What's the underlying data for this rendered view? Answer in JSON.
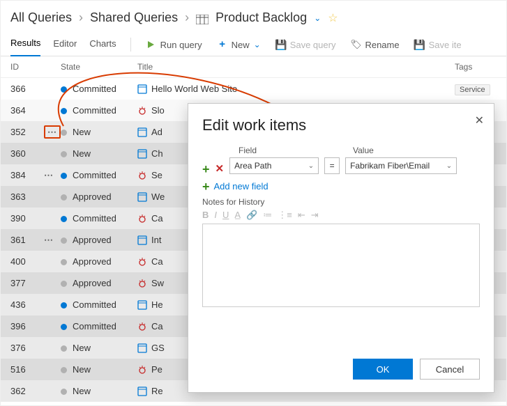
{
  "breadcrumb": {
    "root": "All Queries",
    "mid": "Shared Queries",
    "leaf": "Product Backlog"
  },
  "tabs": {
    "results": "Results",
    "editor": "Editor",
    "charts": "Charts"
  },
  "toolbar": {
    "run": "Run query",
    "new": "New",
    "save": "Save query",
    "rename": "Rename",
    "save_items": "Save ite"
  },
  "columns": {
    "id": "ID",
    "state": "State",
    "title": "Title",
    "tags": "Tags"
  },
  "rows": [
    {
      "id": "366",
      "state": "Committed",
      "dot": "blue",
      "icon": "book",
      "title": "Hello World Web Site",
      "tag": "Service"
    },
    {
      "id": "364",
      "state": "Committed",
      "dot": "blue",
      "icon": "bug",
      "title": "Slo"
    },
    {
      "id": "352",
      "state": "New",
      "dot": "grey",
      "icon": "book",
      "title": "Ad",
      "el": "box"
    },
    {
      "id": "360",
      "state": "New",
      "dot": "grey",
      "icon": "book",
      "title": "Ch"
    },
    {
      "id": "384",
      "state": "Committed",
      "dot": "blue",
      "icon": "bug",
      "title": "Se",
      "el": "dots"
    },
    {
      "id": "363",
      "state": "Approved",
      "dot": "grey",
      "icon": "book",
      "title": "We"
    },
    {
      "id": "390",
      "state": "Committed",
      "dot": "blue",
      "icon": "bug",
      "title": "Ca"
    },
    {
      "id": "361",
      "state": "Approved",
      "dot": "grey",
      "icon": "book",
      "title": "Int",
      "el": "dots"
    },
    {
      "id": "400",
      "state": "Approved",
      "dot": "grey",
      "icon": "bug",
      "title": "Ca"
    },
    {
      "id": "377",
      "state": "Approved",
      "dot": "grey",
      "icon": "bug",
      "title": "Sw"
    },
    {
      "id": "436",
      "state": "Committed",
      "dot": "blue",
      "icon": "book",
      "title": "He"
    },
    {
      "id": "396",
      "state": "Committed",
      "dot": "blue",
      "icon": "bug",
      "title": "Ca"
    },
    {
      "id": "376",
      "state": "New",
      "dot": "grey",
      "icon": "book",
      "title": "GS"
    },
    {
      "id": "516",
      "state": "New",
      "dot": "grey",
      "icon": "bug",
      "title": "Pe"
    },
    {
      "id": "362",
      "state": "New",
      "dot": "grey",
      "icon": "book",
      "title": "Re"
    }
  ],
  "dialog": {
    "title": "Edit work items",
    "field_label": "Field",
    "value_label": "Value",
    "field_value": "Area Path",
    "op": "=",
    "value_value": "Fabrikam Fiber\\Email",
    "add_field": "Add new field",
    "notes_label": "Notes for History",
    "ok": "OK",
    "cancel": "Cancel"
  }
}
